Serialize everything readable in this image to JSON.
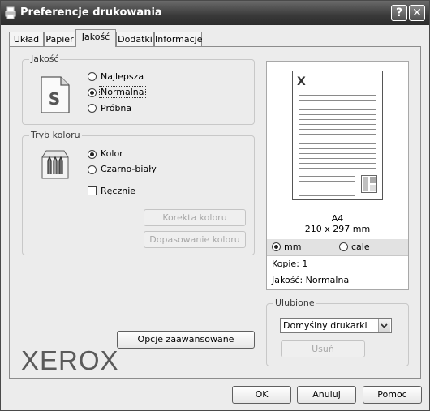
{
  "window": {
    "title": "Preferencje drukowania",
    "help_label": "?",
    "close_label": "✕"
  },
  "tabs": [
    {
      "label": "Układ",
      "active": false
    },
    {
      "label": "Papier",
      "active": false
    },
    {
      "label": "Jakość",
      "active": true
    },
    {
      "label": "Dodatki",
      "active": false
    },
    {
      "label": "Informacje",
      "active": false
    }
  ],
  "quality": {
    "label": "Jakość",
    "icon": "s-document-icon",
    "icon_letter": "S",
    "options": [
      {
        "label": "Najlepsza",
        "selected": false
      },
      {
        "label": "Normalna",
        "selected": true
      },
      {
        "label": "Próbna",
        "selected": false
      }
    ]
  },
  "color_mode": {
    "label": "Tryb koloru",
    "icon": "color-pencils-icon",
    "options": [
      {
        "label": "Kolor",
        "selected": true
      },
      {
        "label": "Czarno-biały",
        "selected": false
      }
    ],
    "manual_label": "Ręcznie",
    "manual_checked": false,
    "buttons": {
      "correction": "Korekta koloru",
      "matching": "Dopasowanie koloru"
    }
  },
  "advanced_button": "Opcje zaawansowane",
  "brand": {
    "logo_text": "XEROX",
    "color": "#5a5a5a"
  },
  "preview": {
    "page_letter": "X",
    "paper_size": "A4",
    "dimensions": "210 x 297 mm",
    "units": [
      {
        "label": "mm",
        "selected": true
      },
      {
        "label": "cale",
        "selected": false
      }
    ],
    "copies": "Kopie: 1",
    "quality": "Jakość: Normalna"
  },
  "favorites": {
    "label": "Ulubione",
    "selected": "Domyślny drukarki",
    "delete_button": "Usuń"
  },
  "footer": {
    "ok": "OK",
    "cancel": "Anuluj",
    "help": "Pomoc"
  }
}
